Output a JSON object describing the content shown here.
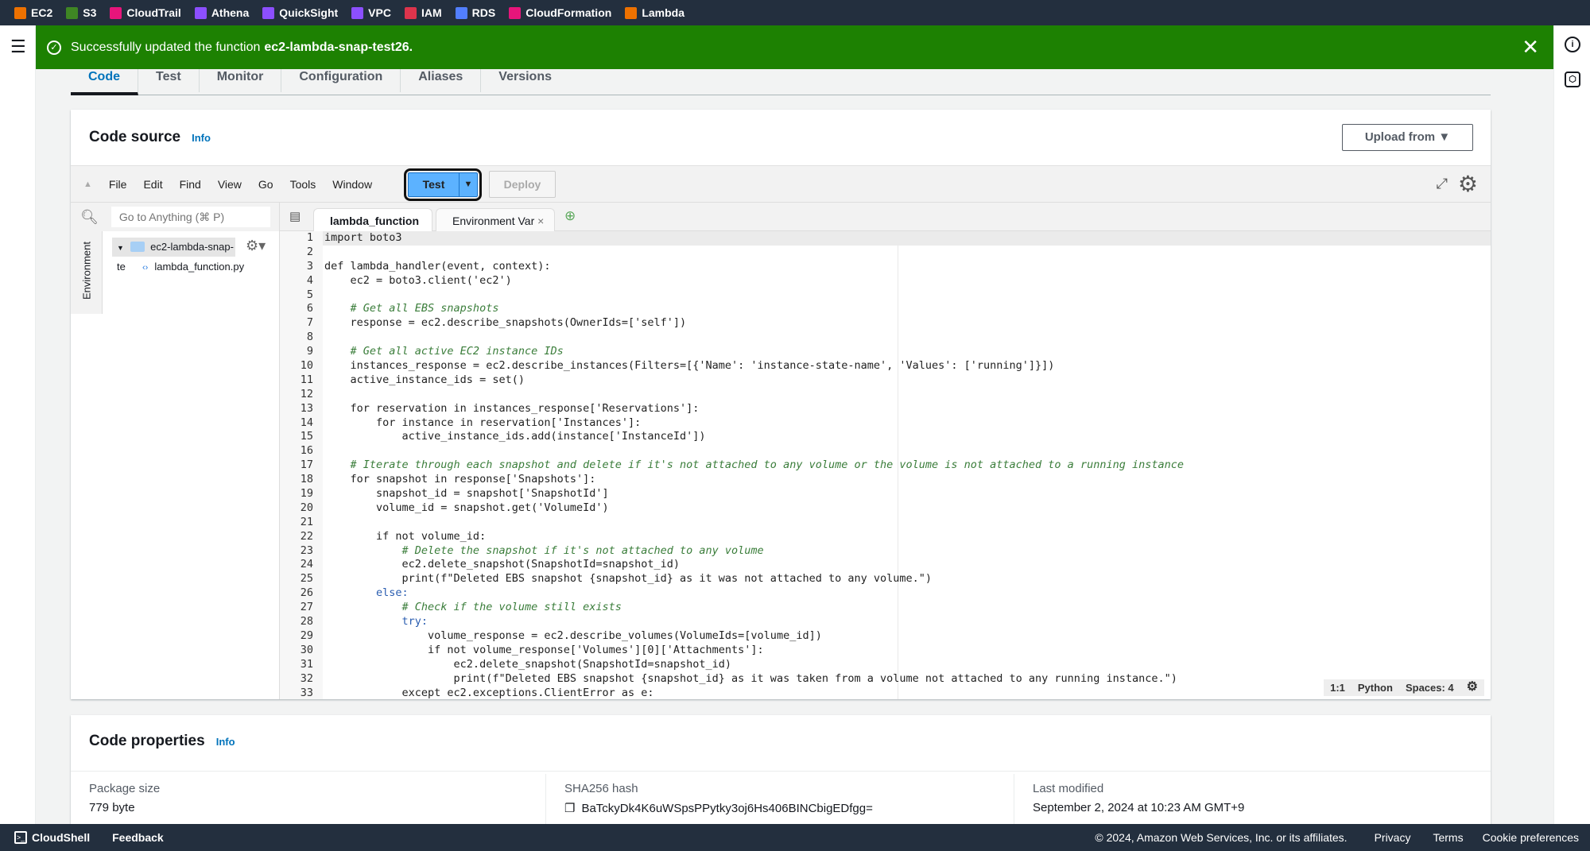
{
  "services": [
    {
      "label": "EC2",
      "color": "#ed7100"
    },
    {
      "label": "S3",
      "color": "#3f8624"
    },
    {
      "label": "CloudTrail",
      "color": "#e7157b"
    },
    {
      "label": "Athena",
      "color": "#8c4fff"
    },
    {
      "label": "QuickSight",
      "color": "#8c4fff"
    },
    {
      "label": "VPC",
      "color": "#8c4fff"
    },
    {
      "label": "IAM",
      "color": "#dd344c"
    },
    {
      "label": "RDS",
      "color": "#527fff"
    },
    {
      "label": "CloudFormation",
      "color": "#e7157b"
    },
    {
      "label": "Lambda",
      "color": "#ed7100"
    }
  ],
  "flash": {
    "message": "Successfully updated the function",
    "function_name": "ec2-lambda-snap-test26.",
    "color": "#1d8102"
  },
  "tabs": [
    "Code",
    "Test",
    "Monitor",
    "Configuration",
    "Aliases",
    "Versions"
  ],
  "code_source": {
    "title": "Code source",
    "info": "Info",
    "upload": "Upload from"
  },
  "toolbar": {
    "menus": [
      "File",
      "Edit",
      "Find",
      "View",
      "Go",
      "Tools",
      "Window"
    ],
    "test": "Test",
    "deploy": "Deploy"
  },
  "tree": {
    "search_placeholder": "Go to Anything (⌘ P)",
    "env_tab": "Environment",
    "folder": "ec2-lambda-snap-te",
    "file": "lambda_function.py"
  },
  "editor_tabs": [
    "lambda_function",
    "Environment Var"
  ],
  "code_lines": [
    "import boto3",
    "",
    "def lambda_handler(event, context):",
    "    ec2 = boto3.client('ec2')",
    "",
    "    # Get all EBS snapshots",
    "    response = ec2.describe_snapshots(OwnerIds=['self'])",
    "",
    "    # Get all active EC2 instance IDs",
    "    instances_response = ec2.describe_instances(Filters=[{'Name': 'instance-state-name', 'Values': ['running']}])",
    "    active_instance_ids = set()",
    "",
    "    for reservation in instances_response['Reservations']:",
    "        for instance in reservation['Instances']:",
    "            active_instance_ids.add(instance['InstanceId'])",
    "",
    "    # Iterate through each snapshot and delete if it's not attached to any volume or the volume is not attached to a running instance",
    "    for snapshot in response['Snapshots']:",
    "        snapshot_id = snapshot['SnapshotId']",
    "        volume_id = snapshot.get('VolumeId')",
    "",
    "        if not volume_id:",
    "            # Delete the snapshot if it's not attached to any volume",
    "            ec2.delete_snapshot(SnapshotId=snapshot_id)",
    "            print(f\"Deleted EBS snapshot {snapshot_id} as it was not attached to any volume.\")",
    "        else:",
    "            # Check if the volume still exists",
    "            try:",
    "                volume_response = ec2.describe_volumes(VolumeIds=[volume_id])",
    "                if not volume_response['Volumes'][0]['Attachments']:",
    "                    ec2.delete_snapshot(SnapshotId=snapshot_id)",
    "                    print(f\"Deleted EBS snapshot {snapshot_id} as it was taken from a volume not attached to any running instance.\")",
    "            except ec2.exceptions.ClientError as e:"
  ],
  "status": {
    "position": "1:1",
    "language": "Python",
    "spaces": "Spaces: 4"
  },
  "code_properties": {
    "title": "Code properties",
    "info": "Info",
    "package_size_label": "Package size",
    "package_size": "779 byte",
    "sha_label": "SHA256 hash",
    "sha": "BaTckyDk4K6uWSpsPPytky3oj6Hs406BINCbigEDfgg=",
    "modified_label": "Last modified",
    "modified": "September 2, 2024 at 10:23 AM GMT+9"
  },
  "footer": {
    "cloudshell": "CloudShell",
    "feedback": "Feedback",
    "copyright": "© 2024, Amazon Web Services, Inc. or its affiliates.",
    "privacy": "Privacy",
    "terms": "Terms",
    "cookies": "Cookie preferences"
  }
}
